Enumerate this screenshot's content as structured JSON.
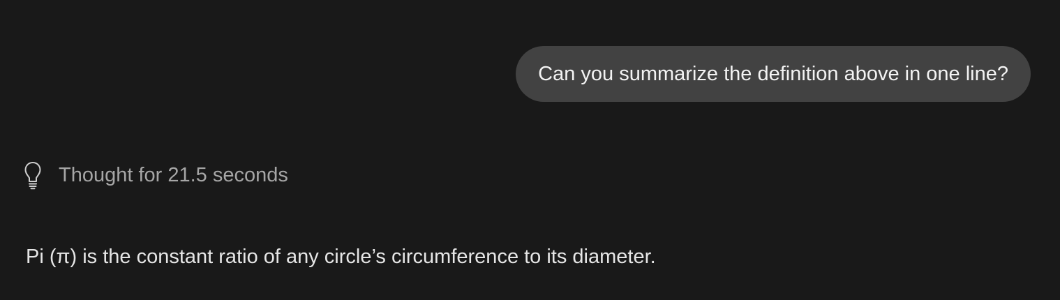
{
  "colors": {
    "background": "#191919",
    "user_bubble": "#424242",
    "user_text": "#f3f3f3",
    "thought_text": "#a6a6a6",
    "assistant_text": "#e6e6e6"
  },
  "conversation": {
    "user_message": "Can you summarize the definition above in one line?",
    "thought": {
      "icon": "lightbulb-icon",
      "label": "Thought for 21.5 seconds"
    },
    "assistant_message": "Pi (π) is the constant ratio of any circle’s circumference to its diameter."
  }
}
